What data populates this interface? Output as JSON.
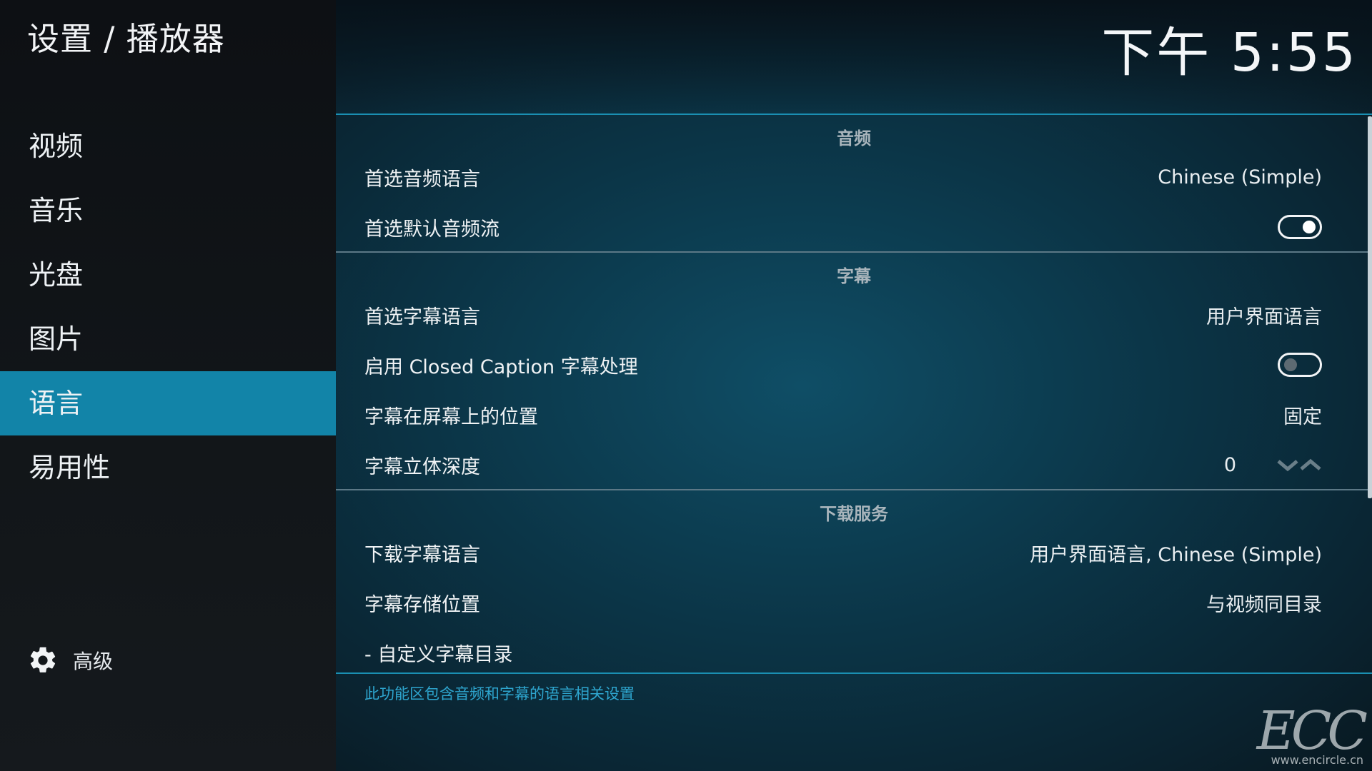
{
  "sidebar": {
    "title": "设置 / 播放器",
    "items": [
      {
        "label": "视频"
      },
      {
        "label": "音乐"
      },
      {
        "label": "光盘"
      },
      {
        "label": "图片"
      },
      {
        "label": "语言",
        "active": true
      },
      {
        "label": "易用性"
      }
    ],
    "advanced_label": "高级",
    "advanced_icon": "gear-icon"
  },
  "header": {
    "clock": "下午 5:55"
  },
  "sections": {
    "audio": {
      "title": "音频",
      "rows": [
        {
          "label": "首选音频语言",
          "value": "Chinese (Simple)"
        },
        {
          "label": "首选默认音频流",
          "toggle": "on"
        }
      ]
    },
    "subtitles": {
      "title": "字幕",
      "rows": [
        {
          "label": "首选字幕语言",
          "value": "用户界面语言"
        },
        {
          "label": "启用 Closed Caption 字幕处理",
          "toggle": "off"
        },
        {
          "label": "字幕在屏幕上的位置",
          "value": "固定"
        },
        {
          "label": "字幕立体深度",
          "value": "0"
        }
      ]
    },
    "download": {
      "title": "下载服务",
      "rows": [
        {
          "label": "下载字幕语言",
          "value": "用户界面语言, Chinese (Simple)"
        },
        {
          "label": "字幕存储位置",
          "value": "与视频同目录"
        },
        {
          "label": "- 自定义字幕目录",
          "value": ""
        }
      ]
    }
  },
  "description": "此功能区包含音频和字幕的语言相关设置",
  "watermark": {
    "logo": "ECC",
    "url": "www.encircle.cn"
  },
  "colors": {
    "accent": "#1284a8",
    "description": "#2ea6cf"
  }
}
